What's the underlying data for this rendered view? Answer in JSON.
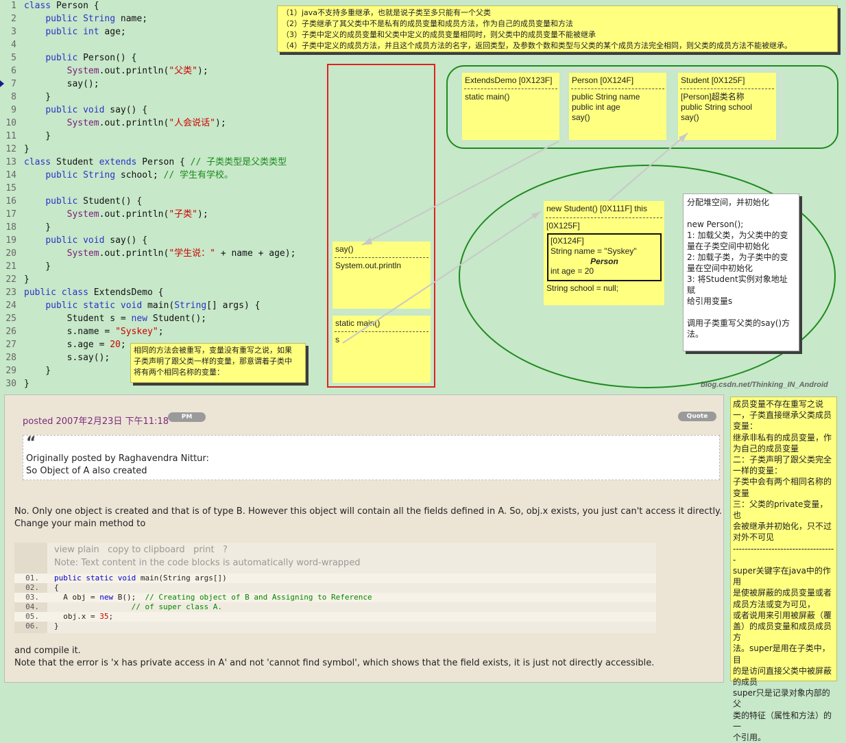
{
  "code": [
    {
      "n": "1",
      "segs": [
        [
          "kw",
          "class"
        ],
        [
          "t",
          " Person {"
        ]
      ]
    },
    {
      "n": "2",
      "segs": [
        [
          "t",
          "    "
        ],
        [
          "kw",
          "public"
        ],
        [
          "t",
          " "
        ],
        [
          "kw",
          "String"
        ],
        [
          "t",
          " name;"
        ]
      ]
    },
    {
      "n": "3",
      "segs": [
        [
          "t",
          "    "
        ],
        [
          "kw",
          "public"
        ],
        [
          "t",
          " "
        ],
        [
          "kw",
          "int"
        ],
        [
          "t",
          " age;"
        ]
      ]
    },
    {
      "n": "4",
      "segs": []
    },
    {
      "n": "5",
      "segs": [
        [
          "t",
          "    "
        ],
        [
          "kw",
          "public"
        ],
        [
          "t",
          " Person() {"
        ]
      ]
    },
    {
      "n": "6",
      "segs": [
        [
          "t",
          "        "
        ],
        [
          "cls",
          "System"
        ],
        [
          "t",
          ".out.println("
        ],
        [
          "str",
          "\"父类\""
        ],
        [
          "t",
          ");"
        ]
      ]
    },
    {
      "n": "7",
      "segs": [
        [
          "t",
          "        say();"
        ]
      ]
    },
    {
      "n": "8",
      "segs": [
        [
          "t",
          "    }"
        ]
      ]
    },
    {
      "n": "9",
      "segs": [
        [
          "t",
          "    "
        ],
        [
          "kw",
          "public"
        ],
        [
          "t",
          " "
        ],
        [
          "kw",
          "void"
        ],
        [
          "t",
          " say() {"
        ]
      ]
    },
    {
      "n": "10",
      "segs": [
        [
          "t",
          "        "
        ],
        [
          "cls",
          "System"
        ],
        [
          "t",
          ".out.println("
        ],
        [
          "str",
          "\"人会说话\""
        ],
        [
          "t",
          ");"
        ]
      ]
    },
    {
      "n": "11",
      "segs": [
        [
          "t",
          "    }"
        ]
      ]
    },
    {
      "n": "12",
      "segs": [
        [
          "t",
          "}"
        ]
      ]
    },
    {
      "n": "13",
      "segs": [
        [
          "kw",
          "class"
        ],
        [
          "t",
          " Student "
        ],
        [
          "kw",
          "extends"
        ],
        [
          "t",
          " Person { "
        ],
        [
          "cm",
          "// 子类类型是父类类型"
        ]
      ]
    },
    {
      "n": "14",
      "segs": [
        [
          "t",
          "    "
        ],
        [
          "kw",
          "public"
        ],
        [
          "t",
          " "
        ],
        [
          "kw",
          "String"
        ],
        [
          "t",
          " school; "
        ],
        [
          "cm",
          "// 学生有学校。"
        ]
      ]
    },
    {
      "n": "15",
      "segs": []
    },
    {
      "n": "16",
      "segs": [
        [
          "t",
          "    "
        ],
        [
          "kw",
          "public"
        ],
        [
          "t",
          " Student() {"
        ]
      ]
    },
    {
      "n": "17",
      "segs": [
        [
          "t",
          "        "
        ],
        [
          "cls",
          "System"
        ],
        [
          "t",
          ".out.println("
        ],
        [
          "str",
          "\"子类\""
        ],
        [
          "t",
          ");"
        ]
      ]
    },
    {
      "n": "18",
      "segs": [
        [
          "t",
          "    }"
        ]
      ]
    },
    {
      "n": "19",
      "segs": [
        [
          "t",
          "    "
        ],
        [
          "kw",
          "public"
        ],
        [
          "t",
          " "
        ],
        [
          "kw",
          "void"
        ],
        [
          "t",
          " say() {"
        ]
      ]
    },
    {
      "n": "20",
      "segs": [
        [
          "t",
          "        "
        ],
        [
          "cls",
          "System"
        ],
        [
          "t",
          ".out.println("
        ],
        [
          "str",
          "\"学生说：\""
        ],
        [
          "t",
          " + name + age);"
        ]
      ]
    },
    {
      "n": "21",
      "segs": [
        [
          "t",
          "    }"
        ]
      ]
    },
    {
      "n": "22",
      "segs": [
        [
          "t",
          "}"
        ]
      ]
    },
    {
      "n": "23",
      "segs": [
        [
          "kw",
          "public"
        ],
        [
          "t",
          " "
        ],
        [
          "kw",
          "class"
        ],
        [
          "t",
          " ExtendsDemo {"
        ]
      ]
    },
    {
      "n": "24",
      "segs": [
        [
          "t",
          "    "
        ],
        [
          "kw",
          "public"
        ],
        [
          "t",
          " "
        ],
        [
          "kw",
          "static"
        ],
        [
          "t",
          " "
        ],
        [
          "kw",
          "void"
        ],
        [
          "t",
          " main("
        ],
        [
          "kw",
          "String"
        ],
        [
          "t",
          "[] args) {"
        ]
      ]
    },
    {
      "n": "25",
      "segs": [
        [
          "t",
          "        Student s = "
        ],
        [
          "kw",
          "new"
        ],
        [
          "t",
          " Student();"
        ]
      ]
    },
    {
      "n": "26",
      "segs": [
        [
          "t",
          "        s.name = "
        ],
        [
          "str",
          "\"Syskey\""
        ],
        [
          "t",
          ";"
        ]
      ]
    },
    {
      "n": "27",
      "segs": [
        [
          "t",
          "        s.age = "
        ],
        [
          "str",
          "20"
        ],
        [
          "t",
          ";"
        ]
      ]
    },
    {
      "n": "28",
      "segs": [
        [
          "t",
          "        s.say();"
        ]
      ]
    },
    {
      "n": "29",
      "segs": [
        [
          "t",
          "    }"
        ]
      ]
    },
    {
      "n": "30",
      "segs": [
        [
          "t",
          "}"
        ]
      ]
    }
  ],
  "top_note": "（1）java不支持多重继承，也就是说子类至多只能有一个父类\n（2）子类继承了其父类中不是私有的成员变量和成员方法，作为自己的成员变量和方法\n（3）子类中定义的成员变量和父类中定义的成员变量相同时，则父类中的成员变量不能被继承\n（4）子类中定义的成员方法，并且这个成员方法的名字，返回类型，及参数个数和类型与父类的某个成员方法完全相同，则父类的成员方法不能被继承。",
  "override_note": "相同的方法会被重写，变量没有重写之说，如果\n子类声明了跟父类一样的变量，那意谓着子类中\n将有两个相同名称的变量：",
  "heap_note": "分配堆空间，并初始化\n\nnew Person();\n1: 加载父类，为父类中的变\n量在子类空间中初始化\n2: 加载子类，为子类中的变\n量在空间中初始化\n3: 将Student实例对象地址赋\n给引用变量s\n\n调用子类重写父类的say()方\n法。",
  "classes": [
    {
      "header": "ExtendsDemo [0X123F]",
      "body": "static main()"
    },
    {
      "header": "Person [0X124F]",
      "body": "public String name\npublic int age\nsay()"
    },
    {
      "header": "Student [0X125F]",
      "body": "[Person]超类名称\npublic String school\nsay()"
    }
  ],
  "stack": [
    {
      "header": "say()",
      "body": "System.out.println"
    },
    {
      "header": "static main()",
      "body": "s"
    }
  ],
  "heap_obj": {
    "header": "new Student() [0X111F] this",
    "addr": "[0X125F]",
    "inner_addr": "[0X124F]",
    "inner_name": "String name = \"Syskey\"",
    "inner_title": "Person",
    "inner_age": "int age = 20",
    "school": "String school = null;"
  },
  "watermark": "blog.csdn.net/Thinking_IN_Android",
  "post": {
    "posted_label": "posted",
    "date": "2007年2月23日 下午11:18",
    "pm_label": "PM",
    "quote_label": "Quote",
    "quote_mark": "“",
    "quote_author": "Originally posted by Raghavendra Nittur:",
    "quote_text": "So Object of A also created",
    "para1": "No. Only one object is created and that is of type B. However this object will contain all the fields defined in A. So, obj.x exists, you just can't access it directly.\nChange your main method to",
    "toolbar": "view plain   copy to clipboard   print   ?",
    "note": "Note: Text content in the code blocks is automatically word-wrapped",
    "code": [
      {
        "n": "01.",
        "segs": [
          [
            "kw",
            "public"
          ],
          [
            "t",
            " "
          ],
          [
            "kw",
            "static"
          ],
          [
            "t",
            " "
          ],
          [
            "kw",
            "void"
          ],
          [
            "t",
            " main(String args[])"
          ]
        ]
      },
      {
        "n": "02.",
        "segs": [
          [
            "t",
            "{"
          ]
        ]
      },
      {
        "n": "03.",
        "segs": [
          [
            "t",
            "  A obj = "
          ],
          [
            "kw",
            "new"
          ],
          [
            "t",
            " B();  "
          ],
          [
            "cm",
            "// Creating object of B and Assigning to Reference"
          ]
        ]
      },
      {
        "n": "04.",
        "segs": [
          [
            "t",
            "                 "
          ],
          [
            "cm",
            "// of super class A."
          ]
        ]
      },
      {
        "n": "05.",
        "segs": [
          [
            "t",
            "  obj.x = "
          ],
          [
            "num",
            "35"
          ],
          [
            "t",
            ";"
          ]
        ]
      },
      {
        "n": "06.",
        "segs": [
          [
            "t",
            "}"
          ]
        ]
      }
    ],
    "para2": "and compile it.\nNote that the error is 'x has private access in A' and not 'cannot find symbol', which shows that the field exists, it is just not directly accessible."
  },
  "side_note": "成员变量不存在重写之说\n一，子类直接继承父类成员\n变量：\n继承非私有的成员变量，作\n为自己的成员变量\n二：子类声明了跟父类完全\n一样的变量：\n子类中会有两个相同名称的\n变量\n三：父类的private变量，也\n会被继承并初始化，只不过\n对外不可见\n-----------------------------------\nsuper关键字在java中的作用\n是使被屏蔽的成员变量或者\n成员方法或变为可见，\n或者说用来引用被屏蔽（覆\n盖）的成员变量和成员成员方\n法。super是用在子类中，目\n的是访问直接父类中被屏蔽\n的成员\nsuper只是记录对象内部的父\n类的特征（属性和方法）的一\n个引用。",
  "colors": {
    "note": "#ffff80",
    "editor_bg": "#c7e8c9",
    "post_bg": "#ece5d6",
    "stack_border": "#e02020",
    "ellipse": "#1e8a1e"
  }
}
